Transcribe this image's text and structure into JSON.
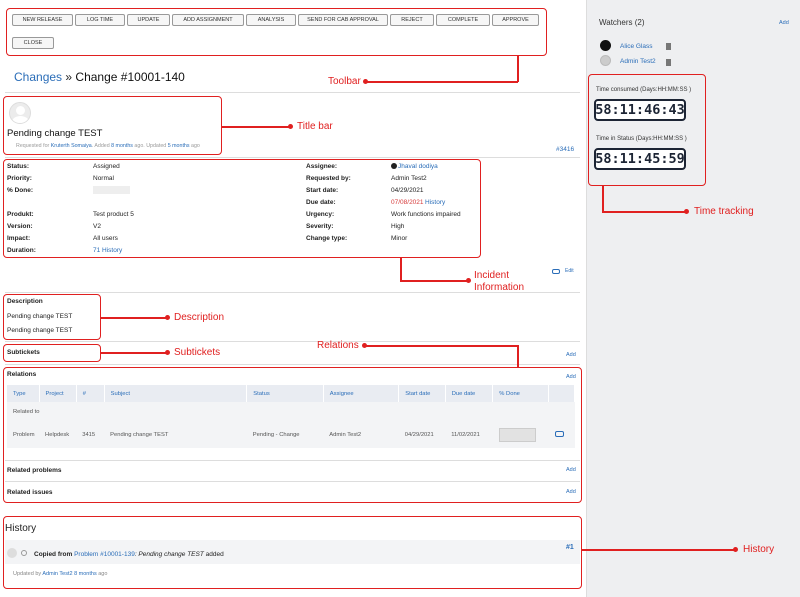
{
  "toolbar": {
    "buttons": [
      "NEW RELEASE",
      "LOG TIME",
      "UPDATE",
      "ADD ASSIGNMENT",
      "ANALYSIS",
      "SEND FOR CAB APPROVAL",
      "REJECT",
      "COMPLETE",
      "APPROVE",
      "CLOSE"
    ]
  },
  "breadcrumb": {
    "parent": "Changes",
    "sep": "»",
    "current": "Change #10001-140"
  },
  "title_bar": {
    "subject": "Pending change TEST",
    "meta_prefix": "Requested for",
    "requester": "Kruterth Somaiya",
    "meta_added": ". Added",
    "added_ago": "8 months",
    "meta_updated": "ago. Updated",
    "updated_ago": "5 months",
    "meta_suffix": "ago",
    "issue_ref": "#3416"
  },
  "info": {
    "left": [
      {
        "label": "Status:",
        "value": "Assigned"
      },
      {
        "label": "Priority:",
        "value": "Normal"
      },
      {
        "label": "% Done:",
        "value": ""
      },
      {
        "label": "Produkt:",
        "value": "Test product 5"
      },
      {
        "label": "Version:",
        "value": "V2"
      },
      {
        "label": "Impact:",
        "value": "All users"
      },
      {
        "label": "Duration:",
        "value": "71 History"
      }
    ],
    "right": [
      {
        "label": "Assignee:",
        "value": "Jhaval dodiya"
      },
      {
        "label": "Requested by:",
        "value": "Admin Test2"
      },
      {
        "label": "Start date:",
        "value": "04/29/2021"
      },
      {
        "label": "Due date:",
        "value": "07/08/2021",
        "extra": "History"
      },
      {
        "label": "Urgency:",
        "value": "Work functions impaired"
      },
      {
        "label": "Severity:",
        "value": "High"
      },
      {
        "label": "Change type:",
        "value": "Minor"
      }
    ],
    "edit_label": "Edit"
  },
  "description": {
    "heading": "Description",
    "lines": [
      "Pending change TEST",
      "Pending change TEST"
    ]
  },
  "subtickets": {
    "heading": "Subtickets",
    "add": "Add"
  },
  "relations": {
    "heading": "Relations",
    "add": "Add",
    "columns": [
      "Type",
      "Project",
      "#",
      "Subject",
      "Status",
      "Assignee",
      "Start date",
      "Due date",
      "% Done"
    ],
    "group": "Related to",
    "rows": [
      {
        "type": "Problem",
        "project": "Helpdesk",
        "num": "3415",
        "subject": "Pending change TEST",
        "status": "Pending - Change",
        "assignee": "Admin Test2",
        "start": "04/29/2021",
        "due": "11/02/2021",
        "done": ""
      }
    ],
    "related_problems": "Related problems",
    "related_issues": "Related issues"
  },
  "history": {
    "heading": "History",
    "entry_prefix": "Copied from",
    "entry_link": "Problem #10001-139",
    "entry_subject": ": Pending change TEST",
    "entry_suffix": "added",
    "entry_num": "#1",
    "updated_prefix": "Updated by",
    "updated_user": "Admin Test2",
    "updated_ago": "8 months",
    "updated_suffix": "ago"
  },
  "sidebar": {
    "watchers_title": "Watchers (2)",
    "watchers_add": "Add",
    "watchers": [
      "Alice Glass",
      "Admin Test2"
    ],
    "time_consumed_label": "Time consumed (Days:HH:MM:SS )",
    "time_consumed": "58:11:46:43",
    "time_status_label": "Time in Status (Days:HH:MM:SS )",
    "time_status": "58:11:45:59"
  },
  "callouts": {
    "toolbar": "Toolbar",
    "title_bar": "Title bar",
    "incident": "Incident\nInformation",
    "description": "Description",
    "subtickets": "Subtickets",
    "relations": "Relations",
    "history": "History",
    "time_tracking": "Time tracking"
  }
}
